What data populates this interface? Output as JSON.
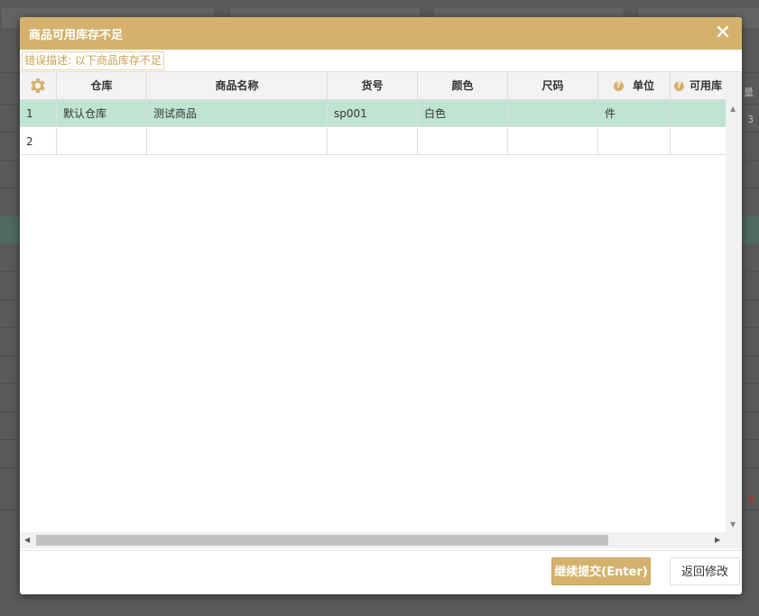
{
  "dialog": {
    "title": "商品可用库存不足",
    "close_icon": "close-icon",
    "error_description": "错误描述: 以下商品库存不足"
  },
  "grid": {
    "settings_icon": "gear-icon",
    "columns": [
      "仓库",
      "商品名称",
      "货号",
      "颜色",
      "尺码",
      "单位",
      "可用库"
    ],
    "help_icon": "question-icon",
    "rows": [
      {
        "index": "1",
        "warehouse": "默认仓库",
        "product": "测试商品",
        "sku": "sp001",
        "color": "白色",
        "size": "",
        "unit": "件",
        "available": ""
      },
      {
        "index": "2",
        "warehouse": "",
        "product": "",
        "sku": "",
        "color": "",
        "size": "",
        "unit": "",
        "available": ""
      }
    ],
    "selected_row": 1
  },
  "footer": {
    "continue_label": "继续提交(Enter)",
    "back_label": "返回修改"
  },
  "background": {
    "edge_text_1": "量",
    "edge_text_2": "3",
    "edge_text_3": "3"
  },
  "colors": {
    "accent": "#d4b26e",
    "selected_row": "#bfe4d2"
  }
}
